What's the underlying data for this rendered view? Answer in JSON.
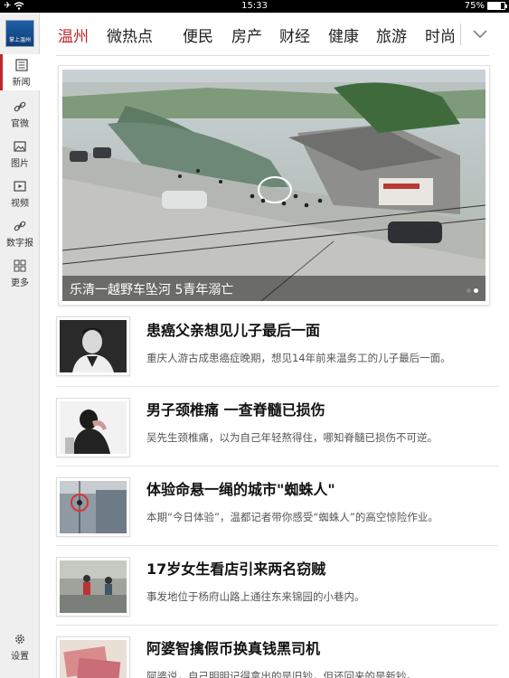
{
  "status_bar": {
    "time": "15:33",
    "battery": "75%",
    "battery_level": 0.75
  },
  "sidebar": {
    "logo_text": "掌上温州",
    "items": [
      {
        "label": "新闻",
        "icon": "news-icon",
        "active": true
      },
      {
        "label": "官微",
        "icon": "weibo-link-icon"
      },
      {
        "label": "图片",
        "icon": "image-icon"
      },
      {
        "label": "视频",
        "icon": "video-icon"
      },
      {
        "label": "数字报",
        "icon": "link-icon"
      },
      {
        "label": "更多",
        "icon": "grid-icon"
      }
    ],
    "settings_label": "设置"
  },
  "tabs": [
    {
      "label": "温州",
      "active": true
    },
    {
      "label": "微热点"
    },
    {
      "label": "便民"
    },
    {
      "label": "房产"
    },
    {
      "label": "财经"
    },
    {
      "label": "健康"
    },
    {
      "label": "旅游"
    },
    {
      "label": "时尚"
    }
  ],
  "hero": {
    "caption": "乐清一越野车坠河 5青年溺亡",
    "slides": 2,
    "current_slide": 2
  },
  "news": [
    {
      "title": "患癌父亲想见儿子最后一面",
      "summary": "重庆人游古成患癌症晚期，想见14年前来温务工的儿子最后一面。"
    },
    {
      "title": "男子颈椎痛 一查脊髓已损伤",
      "summary": "吴先生颈椎痛，以为自己年轻熬得住，哪知脊髓已损伤不可逆。"
    },
    {
      "title": "体验命悬一绳的城市\"蜘蛛人\"",
      "summary": "本期“今日体验”，温都记者带你感受“蜘蛛人”的高空惊险作业。"
    },
    {
      "title": "17岁女生看店引来两名窃贼",
      "summary": "事发地位于杨府山路上通往东来锦园的小巷内。"
    },
    {
      "title": "阿婆智擒假币换真钱黑司机",
      "summary": "阿婆说，自己明明记得拿出的是旧钞，但还回来的是新钞。"
    }
  ],
  "colors": {
    "accent": "#c3252a",
    "sidebar_bg": "#efefef"
  }
}
